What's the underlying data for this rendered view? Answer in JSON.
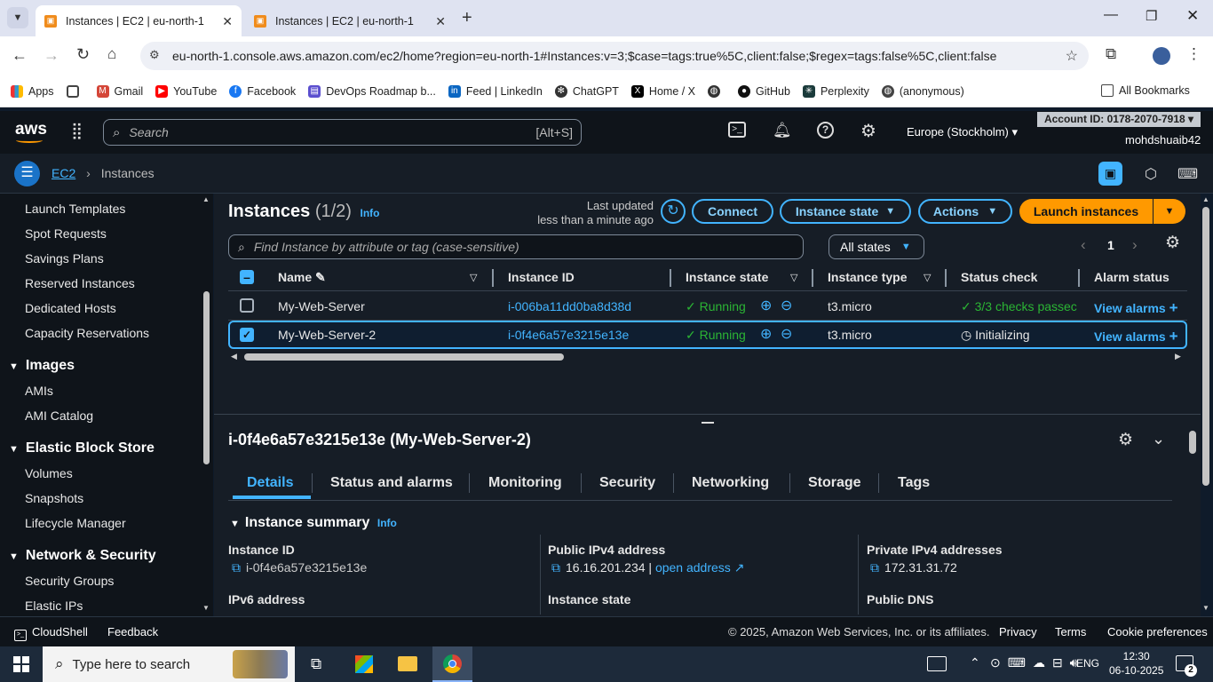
{
  "browser": {
    "tabs": [
      {
        "title": "Instances | EC2 | eu-north-1",
        "active": true
      },
      {
        "title": "Instances | EC2 | eu-north-1",
        "active": false
      }
    ],
    "url": "eu-north-1.console.aws.amazon.com/ec2/home?region=eu-north-1#Instances:v=3;$case=tags:true%5C,client:false;$regex=tags:false%5C,client:false",
    "bookmarks": [
      "Apps",
      "Gmail",
      "YouTube",
      "Facebook",
      "DevOps Roadmap b...",
      "Feed | LinkedIn",
      "ChatGPT",
      "Home / X",
      "GitHub",
      "Perplexity",
      "(anonymous)"
    ],
    "all_bookmarks": "All Bookmarks"
  },
  "aws": {
    "logo": "aws",
    "search_placeholder": "Search",
    "search_shortcut": "[Alt+S]",
    "region": "Europe (Stockholm)",
    "account": "Account ID: 0178-2070-7918",
    "user": "mohdshuaib42"
  },
  "breadcrumb": {
    "service": "EC2",
    "page": "Instances"
  },
  "sidebar": {
    "items_top": [
      "Launch Templates",
      "Spot Requests",
      "Savings Plans",
      "Reserved Instances",
      "Dedicated Hosts",
      "Capacity Reservations"
    ],
    "images_header": "Images",
    "images_items": [
      "AMIs",
      "AMI Catalog"
    ],
    "ebs_header": "Elastic Block Store",
    "ebs_items": [
      "Volumes",
      "Snapshots",
      "Lifecycle Manager"
    ],
    "net_header": "Network & Security",
    "net_items": [
      "Security Groups",
      "Elastic IPs"
    ]
  },
  "instances": {
    "title": "Instances",
    "count": "(1/2)",
    "info": "Info",
    "last_updated": "Last updated",
    "last_updated_value": "less than a minute ago",
    "connect": "Connect",
    "instance_state_btn": "Instance state",
    "actions_btn": "Actions",
    "launch_btn": "Launch instances",
    "filter_placeholder": "Find Instance by attribute or tag (case-sensitive)",
    "states_filter": "All states",
    "page": "1",
    "columns": [
      "Name",
      "Instance ID",
      "Instance state",
      "Instance type",
      "Status check",
      "Alarm status"
    ],
    "rows": [
      {
        "name": "My-Web-Server",
        "id": "i-006ba11dd0ba8d38d",
        "state": "Running",
        "type": "t3.micro",
        "status": "3/3 checks passec",
        "alarm": "View alarms",
        "selected": false
      },
      {
        "name": "My-Web-Server-2",
        "id": "i-0f4e6a57e3215e13e",
        "state": "Running",
        "type": "t3.micro",
        "status": "Initializing",
        "alarm": "View alarms",
        "selected": true
      }
    ]
  },
  "details": {
    "heading": "i-0f4e6a57e3215e13e (My-Web-Server-2)",
    "tabs": [
      "Details",
      "Status and alarms",
      "Monitoring",
      "Security",
      "Networking",
      "Storage",
      "Tags"
    ],
    "summary_title": "Instance summary",
    "summary_info": "Info",
    "instance_id_label": "Instance ID",
    "instance_id": "i-0f4e6a57e3215e13e",
    "public_ipv4_label": "Public IPv4 address",
    "public_ipv4": "16.16.201.234",
    "separator": "|",
    "open_address": "open address",
    "private_ipv4_label": "Private IPv4 addresses",
    "private_ipv4": "172.31.31.72",
    "ipv6_label": "IPv6 address",
    "instance_state_label": "Instance state",
    "public_dns_label": "Public DNS"
  },
  "footer": {
    "cloudshell": "CloudShell",
    "feedback": "Feedback",
    "copyright": "© 2025, Amazon Web Services, Inc. or its affiliates.",
    "privacy": "Privacy",
    "terms": "Terms",
    "cookies": "Cookie preferences"
  },
  "taskbar": {
    "search_placeholder": "Type here to search",
    "lang": "ENG",
    "time": "12:30",
    "date": "06-10-2025",
    "notif_count": "2"
  },
  "colors": {
    "accent": "#42b4ff",
    "launch": "#ff9900",
    "running": "#2bb534",
    "bg": "#161d26"
  }
}
